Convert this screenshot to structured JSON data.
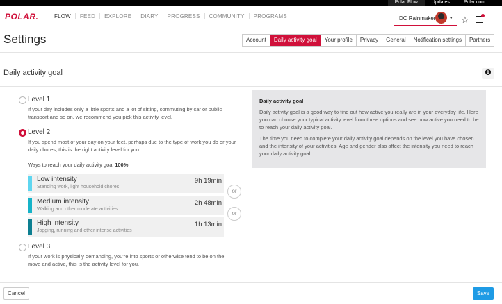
{
  "top_links": [
    "Polar Flow",
    "Updates",
    "Polar.com"
  ],
  "logo": "POLAR.",
  "nav": [
    "FLOW",
    "FEED",
    "EXPLORE",
    "DIARY",
    "PROGRESS",
    "COMMUNITY",
    "PROGRAMS"
  ],
  "user": {
    "name": "DC Rainmaker",
    "caret": "▾"
  },
  "icons": {
    "star": "star-icon",
    "notifications": "notifications-icon",
    "info": "info-icon"
  },
  "page_title": "Settings",
  "tabs": [
    "Account",
    "Daily activity goal",
    "Your profile",
    "Privacy",
    "General",
    "Notification settings",
    "Partners"
  ],
  "active_tab": "Daily activity goal",
  "section_title": "Daily activity goal",
  "levels": [
    {
      "title": "Level 1",
      "desc": "If your day includes only a little sports and a lot of sitting, commuting by car or public transport and so on, we recommend you pick this activity level.",
      "selected": false
    },
    {
      "title": "Level 2",
      "desc": "If you spend most of your day on your feet, perhaps due to the type of work you do or your daily chores, this is the right activity level for you.",
      "selected": true
    },
    {
      "title": "Level 3",
      "desc": "If your work is physically demanding, you're into sports or otherwise tend to be on the move and active, this is the activity level for you.",
      "selected": false
    }
  ],
  "ways": {
    "label": "Ways to reach your daily activity goal",
    "percent": "100%"
  },
  "intensities": [
    {
      "name": "Low intensity",
      "sub": "Standing work, light household chores",
      "time": "9h 19min",
      "color": "#5fd6f0"
    },
    {
      "name": "Medium intensity",
      "sub": "Walking and other moderate activities",
      "time": "2h 48min",
      "color": "#16b3c8"
    },
    {
      "name": "High intensity",
      "sub": "Jogging, running and other intense activities",
      "time": "1h 13min",
      "color": "#0d7f91"
    }
  ],
  "or_label": "or",
  "panel": {
    "title": "Daily activity goal",
    "p1": "Daily activity goal is a good way to find out how active you really are in your everyday life. Here you can choose your typical activity level from three options and see how active you need to be to reach your daily activity goal.",
    "p2": "The time you need to complete your daily activity goal depends on the level you have chosen and the intensity of your activities. Age and gender also affect the intensity you need to reach your daily activity goal."
  },
  "buttons": {
    "cancel": "Cancel",
    "save": "Save"
  },
  "colors": {
    "accent": "#d0103a",
    "save": "#1e9be5"
  }
}
